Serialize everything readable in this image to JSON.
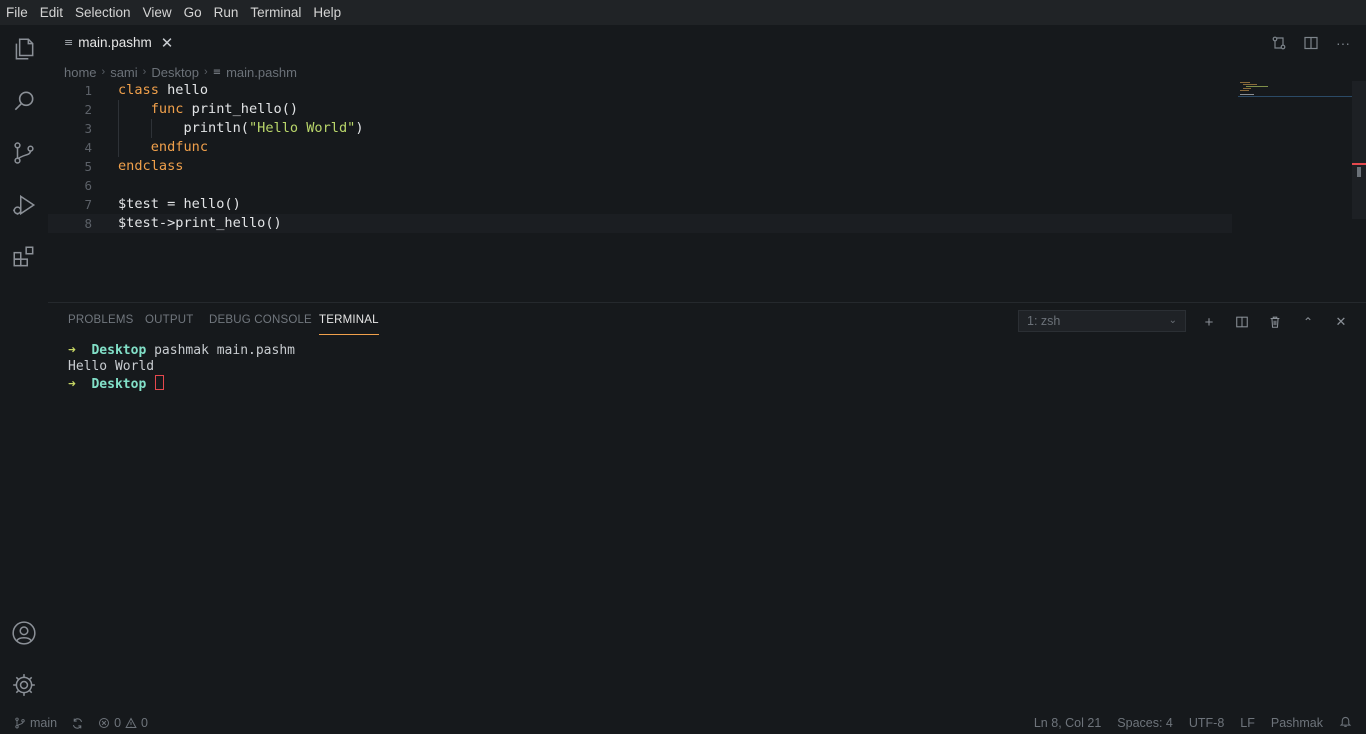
{
  "menu": [
    "File",
    "Edit",
    "Selection",
    "View",
    "Go",
    "Run",
    "Terminal",
    "Help"
  ],
  "activity_bar": [
    "files-icon",
    "search-icon",
    "source-control-icon",
    "run-debug-icon",
    "extensions-icon",
    "account-icon",
    "settings-gear-icon"
  ],
  "tab": {
    "label": "main.pashm"
  },
  "breadcrumb": [
    "home",
    "sami",
    "Desktop",
    "main.pashm"
  ],
  "editor": {
    "current_line": 8,
    "lines": [
      {
        "num": "1",
        "tokens": [
          {
            "t": "class",
            "c": "kw"
          },
          {
            "t": " hello",
            "c": "id"
          }
        ]
      },
      {
        "num": "2",
        "tokens": [
          {
            "t": "    ",
            "c": "id"
          },
          {
            "t": "func",
            "c": "kw"
          },
          {
            "t": " print_hello()",
            "c": "id"
          }
        ]
      },
      {
        "num": "3",
        "tokens": [
          {
            "t": "        println(",
            "c": "id"
          },
          {
            "t": "\"Hello World\"",
            "c": "str"
          },
          {
            "t": ")",
            "c": "id"
          }
        ]
      },
      {
        "num": "4",
        "tokens": [
          {
            "t": "    ",
            "c": "id"
          },
          {
            "t": "endfunc",
            "c": "kw"
          }
        ]
      },
      {
        "num": "5",
        "tokens": [
          {
            "t": "endclass",
            "c": "kw"
          }
        ]
      },
      {
        "num": "6",
        "tokens": []
      },
      {
        "num": "7",
        "tokens": [
          {
            "t": "$test = hello()",
            "c": "id"
          }
        ]
      },
      {
        "num": "8",
        "tokens": [
          {
            "t": "$test->print_hello()",
            "c": "id"
          }
        ]
      }
    ]
  },
  "panel": {
    "tabs": [
      "PROBLEMS",
      "OUTPUT",
      "DEBUG CONSOLE",
      "TERMINAL"
    ],
    "active_tab": "TERMINAL",
    "terminal_select": "1: zsh",
    "terminal": {
      "prompt_arrow": "➜",
      "prompt_dir": "Desktop",
      "command": "pashmak main.pashm",
      "output": "Hello World"
    }
  },
  "status": {
    "branch": "main",
    "errors": "0",
    "warnings": "0",
    "position": "Ln 8, Col 21",
    "spaces": "Spaces: 4",
    "encoding": "UTF-8",
    "eol": "LF",
    "language": "Pashmak"
  },
  "colors": {
    "keyword": "#f0a04b",
    "string": "#b9d66a",
    "prompt_dir": "#82e0c8",
    "active_tab_underline": "#f0a04b"
  }
}
